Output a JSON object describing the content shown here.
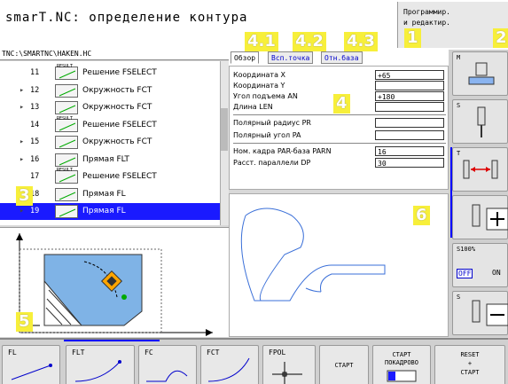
{
  "title": "smarT.NC: определение контура",
  "mode": [
    "Программир.",
    "и редактир."
  ],
  "path": "TNC:\\SMARTNC\\HAKEN.HC",
  "badges": {
    "b1": "1",
    "b2": "2",
    "b3": "3",
    "b41": "4.1",
    "b42": "4.2",
    "b43": "4.3",
    "b4": "4",
    "b5": "5",
    "b6": "6"
  },
  "tree": [
    {
      "num": "11",
      "text": "Решение FSELECT",
      "icon": "RESULT",
      "expand": ""
    },
    {
      "num": "12",
      "text": "Окружность FCT",
      "icon": "",
      "expand": "▸"
    },
    {
      "num": "13",
      "text": "Окружность FCT",
      "icon": "",
      "expand": "▸"
    },
    {
      "num": "14",
      "text": "Решение FSELECT",
      "icon": "RESULT",
      "expand": ""
    },
    {
      "num": "15",
      "text": "Окружность FCT",
      "icon": "",
      "expand": "▸"
    },
    {
      "num": "16",
      "text": "Прямая FLT",
      "icon": "",
      "expand": "▸"
    },
    {
      "num": "17",
      "text": "Решение FSELECT",
      "icon": "RESULT",
      "expand": ""
    },
    {
      "num": "18",
      "text": "Прямая FL",
      "icon": "",
      "expand": ""
    },
    {
      "num": "19",
      "text": "Прямая FL",
      "icon": "",
      "expand": "▸"
    }
  ],
  "tabs": [
    "Обзор",
    "Всп.точка",
    "Отн.база"
  ],
  "form": [
    {
      "label": "Координата X",
      "value": "+65"
    },
    {
      "label": "Координата Y",
      "value": ""
    },
    {
      "label": "Угол подъема AN",
      "value": "+180"
    },
    {
      "label": "Длина LEN",
      "value": ""
    },
    {
      "label": "Полярный радиус PR",
      "value": ""
    },
    {
      "label": "Полярный угол PA",
      "value": ""
    },
    {
      "label": "Ном. кадра PAR-база PARN",
      "value": "16"
    },
    {
      "label": "Расст. параллели DP",
      "value": "30"
    }
  ],
  "right_buttons": {
    "m": "M",
    "s1": "S",
    "t": "T",
    "s100": "S100%",
    "off": "OFF",
    "on": "ON",
    "s2": "S"
  },
  "softkeys": {
    "fl": "FL",
    "flt": "FLT",
    "fc": "FC",
    "fct": "FCT",
    "fpol": "FPOL",
    "start": "СТАРТ",
    "start_step_1": "СТАРТ",
    "start_step_2": "ПОКАДРОВО",
    "reset_1": "RESET",
    "reset_2": "+",
    "reset_3": "СТАРТ"
  },
  "colors": {
    "selection": "#1a1aff",
    "badge": "#f7ef3a",
    "contour": "#3a6fd8",
    "accent": "#0000ff"
  }
}
